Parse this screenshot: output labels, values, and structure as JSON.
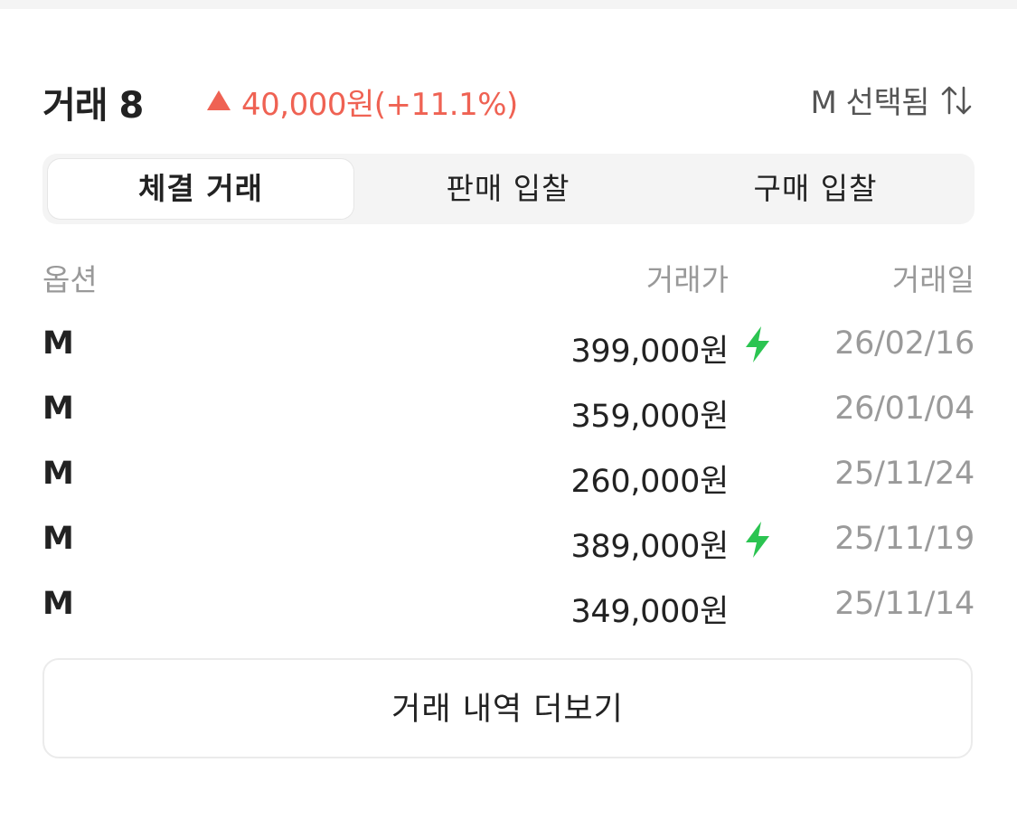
{
  "header": {
    "title": "거래 8",
    "change": "40,000원(+11.1%)",
    "selected": "M 선택됨",
    "change_icon": "triangle-up-icon",
    "sort_icon": "sort-arrows-icon"
  },
  "tabs": [
    {
      "label": "체결 거래",
      "active": true
    },
    {
      "label": "판매 입찰",
      "active": false
    },
    {
      "label": "구매 입찰",
      "active": false
    }
  ],
  "table": {
    "headers": {
      "option": "옵션",
      "price": "거래가",
      "date": "거래일"
    },
    "rows": [
      {
        "option": "M",
        "price": "399,000원",
        "fast": true,
        "date": "26/02/16"
      },
      {
        "option": "M",
        "price": "359,000원",
        "fast": false,
        "date": "26/01/04"
      },
      {
        "option": "M",
        "price": "260,000원",
        "fast": false,
        "date": "25/11/24"
      },
      {
        "option": "M",
        "price": "389,000원",
        "fast": true,
        "date": "25/11/19"
      },
      {
        "option": "M",
        "price": "349,000원",
        "fast": false,
        "date": "25/11/14"
      }
    ]
  },
  "more_button": {
    "label": "거래 내역 더보기"
  },
  "colors": {
    "up": "#ef6253",
    "fast": "#2bc451",
    "muted": "#9a9a9a"
  }
}
